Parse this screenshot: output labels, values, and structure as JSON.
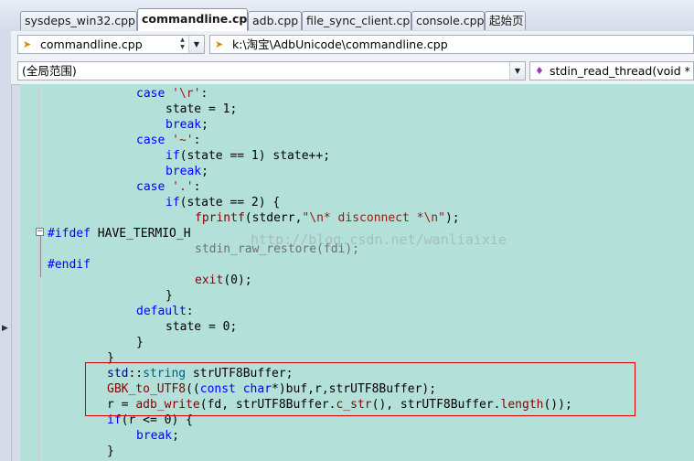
{
  "tabs": [
    {
      "label": "sysdeps_win32.cpp",
      "active": false
    },
    {
      "label": "commandline.cpp",
      "active": true
    },
    {
      "label": "adb.cpp",
      "active": false
    },
    {
      "label": "file_sync_client.cpp",
      "active": false
    },
    {
      "label": "console.cpp",
      "active": false
    },
    {
      "label": "起始页",
      "active": false
    }
  ],
  "nav": {
    "file_combo": "commandline.cpp",
    "path_combo": "k:\\淘宝\\AdbUnicode\\commandline.cpp",
    "scope_combo": "(全局范围)",
    "member_combo": "stdin_read_thread(void * x)"
  },
  "colors": {
    "editor_background": "#b3e1d9",
    "keyword": "#0000ff",
    "highlight_box": "#d80000"
  },
  "code": {
    "l01": {
      "kw": "case",
      "str": "'\\r'",
      "rest": ":"
    },
    "l02": {
      "text": "state = 1;"
    },
    "l03": {
      "kw": "break",
      "rest": ";"
    },
    "l04": {
      "kw": "case",
      "str": "'~'",
      "rest": ":"
    },
    "l05": {
      "kw": "if",
      "rest": "(state == 1) state++;"
    },
    "l06": {
      "kw": "break",
      "rest": ";"
    },
    "l07": {
      "kw": "case",
      "str": "'.'",
      "rest": ":"
    },
    "l08": {
      "kw": "if",
      "rest": "(state == 2) {"
    },
    "l09": {
      "fn": "fprintf",
      "a": "(stderr,",
      "str": "\"\\n* disconnect *\\n\"",
      "rest": ");"
    },
    "l10": {
      "pp": "#ifdef",
      "rest": " HAVE_TERMIO_H"
    },
    "l11": {
      "text": "stdin_raw_restore(fdi);"
    },
    "l12": {
      "pp": "#endif"
    },
    "l13": {
      "fn": "exit",
      "rest": "(0);"
    },
    "l14": {
      "text": "}"
    },
    "l15": {
      "kw": "default",
      "rest": ":"
    },
    "l16": {
      "text": "state = 0;"
    },
    "l17": {
      "text": "}"
    },
    "l18": {
      "text": "}"
    },
    "l19": {
      "ns": "std",
      "sep": "::",
      "ty": "string",
      "rest": " strUTF8Buffer;"
    },
    "l20": {
      "fn": "GBK_to_UTF8",
      "a": "((",
      "kw": "const",
      "b": " ",
      "kw2": "char",
      "rest": "*)buf,r,strUTF8Buffer);"
    },
    "l21": {
      "a": "r = ",
      "fn": "adb_write",
      "b": "(fd, strUTF8Buffer.",
      "fn2": "c_str",
      "c": "(), strUTF8Buffer.",
      "fn3": "length",
      "rest": "());"
    },
    "l22": {
      "kw": "if",
      "rest": "(r <= 0) {"
    },
    "l23": {
      "kw": "break",
      "rest": ";"
    },
    "l24": {
      "text": "}"
    }
  },
  "watermark": "http://blog.csdn.net/wanliaixie"
}
